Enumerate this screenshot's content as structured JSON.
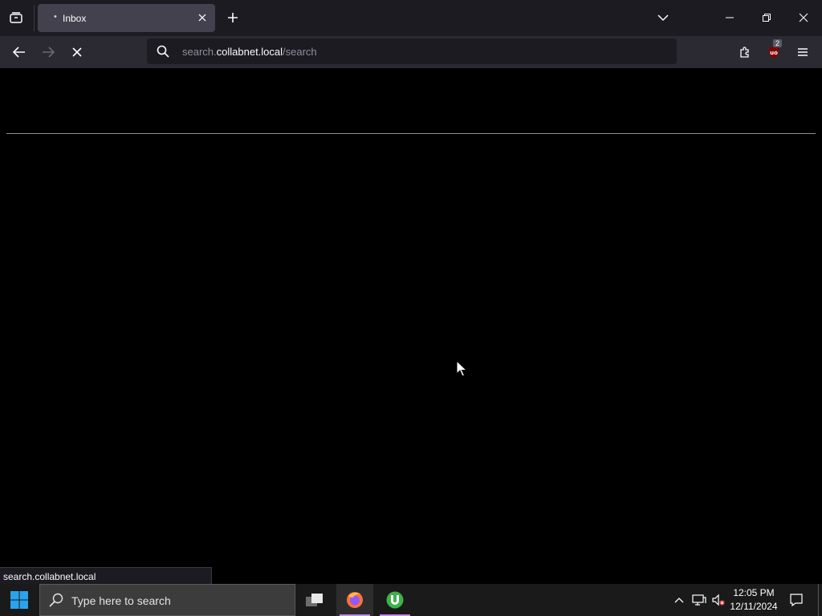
{
  "browser": {
    "tab": {
      "title": "Inbox",
      "loading_dot": "•"
    },
    "url": {
      "prefix": "search.",
      "host": "collabnet.local",
      "path": "/search"
    },
    "extension_badge": "2"
  },
  "status_bar": {
    "text": "search.collabnet.local"
  },
  "taskbar": {
    "search_placeholder": "Type here to search",
    "time": "12:05 PM",
    "date": "12/11/2024"
  },
  "colors": {
    "accent": "#c38ae8",
    "tab_bg": "#42414d",
    "toolbar_bg": "#2b2a33",
    "titlebar_bg": "#1c1b22"
  }
}
